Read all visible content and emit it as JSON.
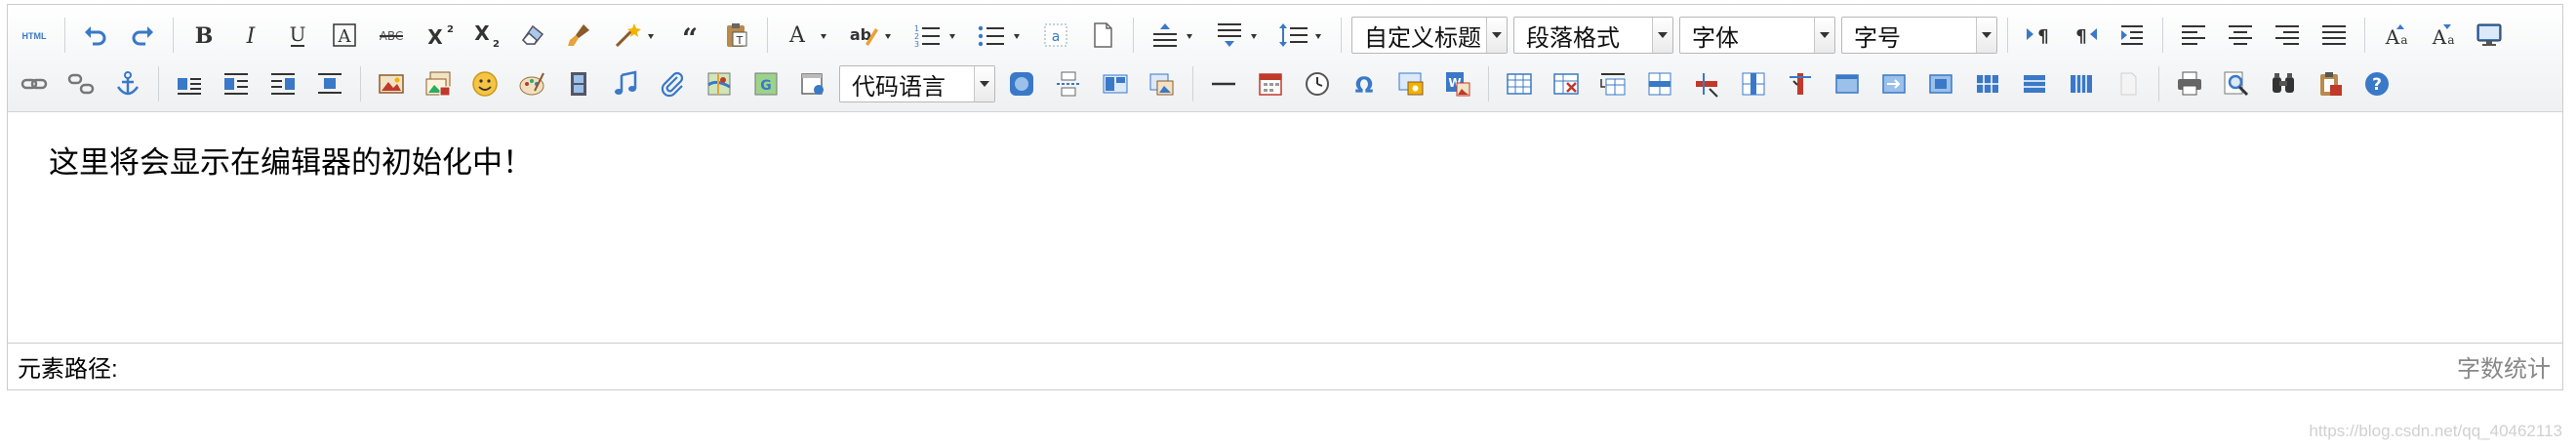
{
  "toolbar": {
    "html_label": "HTML",
    "custom_heading": "自定义标题",
    "paragraph_format": "段落格式",
    "font_family": "字体",
    "font_size": "字号",
    "code_language": "代码语言"
  },
  "content": {
    "text": "这里将会显示在编辑器的初始化中！"
  },
  "bottombar": {
    "element_path": "元素路径:",
    "word_count": "字数统计"
  },
  "watermark": {
    "text": "https://blog.csdn.net/qq_40462113"
  },
  "colors": {
    "accent_blue": "#3a78c8",
    "toolbar_bg": "#f4f5f6",
    "border": "#cccccc"
  }
}
